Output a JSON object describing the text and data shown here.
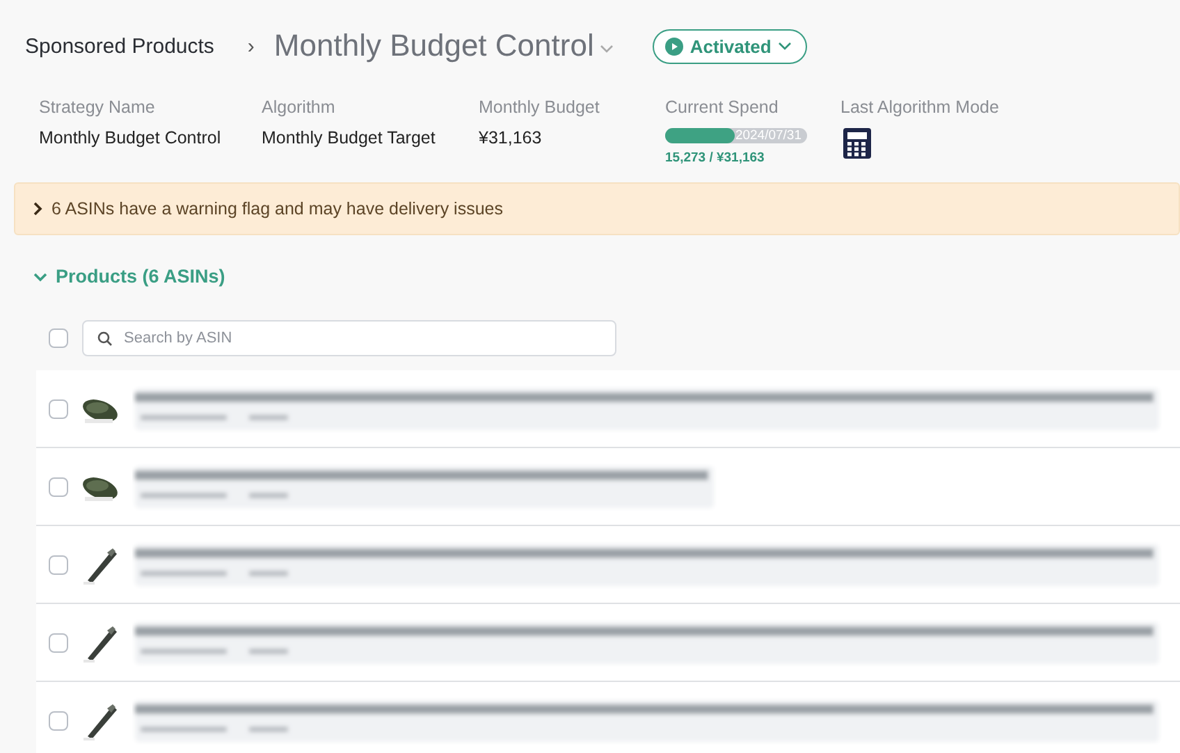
{
  "breadcrumb": {
    "parent": "Sponsored Products",
    "separator": "›",
    "title": "Monthly Budget Control"
  },
  "status": {
    "label": "Activated",
    "active": true
  },
  "summary": {
    "strategy_name": {
      "label": "Strategy Name",
      "value": "Monthly Budget Control"
    },
    "algorithm": {
      "label": "Algorithm",
      "value": "Monthly Budget Target"
    },
    "monthly_budget": {
      "label": "Monthly Budget",
      "value": "¥31,163"
    },
    "current_spend": {
      "label": "Current Spend",
      "level": 0.49,
      "date": "2024/07/31",
      "reading": "15,273 / ¥31,163"
    },
    "last_algorithm_mode": {
      "label": "Last Algorithm Mode"
    }
  },
  "warning": {
    "text": "6 ASINs have a warning flag and may have delivery issues",
    "expanded": false
  },
  "products": {
    "title": "Products (6 ASINs)",
    "expanded": true,
    "select_all_checked": false,
    "search_placeholder": "Search by ASIN",
    "rows": [
      {
        "checked": false
      },
      {
        "checked": false
      },
      {
        "checked": false
      },
      {
        "checked": false
      },
      {
        "checked": false
      }
    ]
  }
}
